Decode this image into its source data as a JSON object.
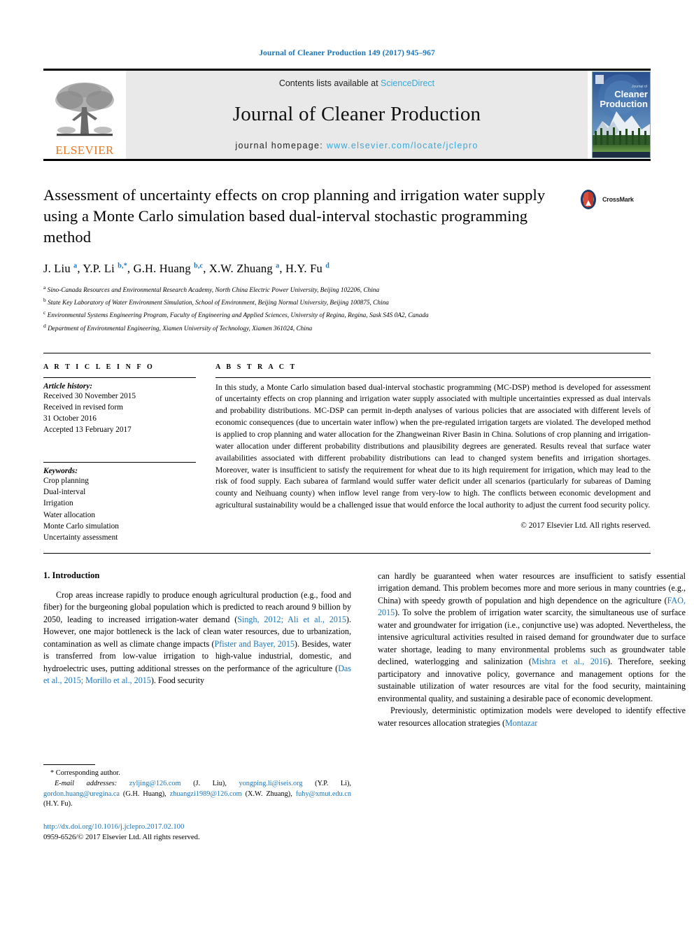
{
  "running_head": "Journal of Cleaner Production 149 (2017) 945–967",
  "masthead": {
    "publisher": "ELSEVIER",
    "contents_prefix": "Contents lists available at ",
    "contents_link": "ScienceDirect",
    "journal_title": "Journal of Cleaner Production",
    "homepage_prefix": "journal homepage: ",
    "homepage_url": "www.elsevier.com/locate/jclepro",
    "cover_line1": "Journal of",
    "cover_line2": "Cleaner",
    "cover_line3": "Production"
  },
  "article": {
    "title": "Assessment of uncertainty effects on crop planning and irrigation water supply using a Monte Carlo simulation based dual-interval stochastic programming method",
    "authors": "J. Liu a, Y.P. Li b,*, G.H. Huang b,c, X.W. Zhuang a, H.Y. Fu d",
    "author_parts": [
      {
        "name": "J. Liu ",
        "sup": "a"
      },
      {
        "name": ", Y.P. Li ",
        "sup": "b,*"
      },
      {
        "name": ", G.H. Huang ",
        "sup": "b,c"
      },
      {
        "name": ", X.W. Zhuang ",
        "sup": "a"
      },
      {
        "name": ", H.Y. Fu ",
        "sup": "d"
      }
    ],
    "affiliations": [
      {
        "marker": "a",
        "text": "Sino-Canada Resources and Environmental Research Academy, North China Electric Power University, Beijing 102206, China"
      },
      {
        "marker": "b",
        "text": "State Key Laboratory of Water Environment Simulation, School of Environment, Beijing Normal University, Beijing 100875, China"
      },
      {
        "marker": "c",
        "text": "Environmental Systems Engineering Program, Faculty of Engineering and Applied Sciences, University of Regina, Regina, Sask S4S 0A2, Canada"
      },
      {
        "marker": "d",
        "text": "Department of Environmental Engineering, Xiamen University of Technology, Xiamen 361024, China"
      }
    ],
    "crossmark_label": "CrossMark"
  },
  "article_info": {
    "heading": "A R T I C L E   I N F O",
    "history_label": "Article history:",
    "history": [
      "Received 30 November 2015",
      "Received in revised form",
      "31 October 2016",
      "Accepted 13 February 2017"
    ],
    "keywords_label": "Keywords:",
    "keywords": [
      "Crop planning",
      "Dual-interval",
      "Irrigation",
      "Water allocation",
      "Monte Carlo simulation",
      "Uncertainty assessment"
    ]
  },
  "abstract": {
    "heading": "A B S T R A C T",
    "text": "In this study, a Monte Carlo simulation based dual-interval stochastic programming (MC-DSP) method is developed for assessment of uncertainty effects on crop planning and irrigation water supply associated with multiple uncertainties expressed as dual intervals and probability distributions. MC-DSP can permit in-depth analyses of various policies that are associated with different levels of economic consequences (due to uncertain water inflow) when the pre-regulated irrigation targets are violated. The developed method is applied to crop planning and water allocation for the Zhangweinan River Basin in China. Solutions of crop planning and irrigation-water allocation under different probability distributions and plausibility degrees are generated. Results reveal that surface water availabilities associated with different probability distributions can lead to changed system benefits and irrigation shortages. Moreover, water is insufficient to satisfy the requirement for wheat due to its high requirement for irrigation, which may lead to the risk of food supply. Each subarea of farmland would suffer water deficit under all scenarios (particularly for subareas of Daming county and Neihuang county) when inflow level range from very-low to high. The conflicts between economic development and agricultural sustainability would be a challenged issue that would enforce the local authority to adjust the current food security policy.",
    "copyright": "© 2017 Elsevier Ltd. All rights reserved."
  },
  "body": {
    "section_title": "1. Introduction",
    "left_paragraph_1_a": "Crop areas increase rapidly to produce enough agricultural production (e.g., food and fiber) for the burgeoning global population which is predicted to reach around 9 billion by 2050, leading to increased irrigation-water demand (",
    "left_ref_1": "Singh, 2012; Ali et al., 2015",
    "left_paragraph_1_b": "). However, one major bottleneck is the lack of clean water resources, due to urbanization, contamination as well as climate change impacts (",
    "left_ref_2": "Pfister and Bayer, 2015",
    "left_paragraph_1_c": "). Besides, water is transferred from low-value irrigation to high-value industrial, domestic, and hydroelectric uses, putting additional stresses on the performance of the agriculture (",
    "left_ref_3": "Das et al., 2015; Morillo et al., 2015",
    "left_paragraph_1_d": "). Food security",
    "right_paragraph_1_a": "can hardly be guaranteed when water resources are insufficient to satisfy essential irrigation demand. This problem becomes more and more serious in many countries (e.g., China) with speedy growth of population and high dependence on the agriculture (",
    "right_ref_1": "FAO, 2015",
    "right_paragraph_1_b": "). To solve the problem of irrigation water scarcity, the simultaneous use of surface water and groundwater for irrigation (i.e., conjunctive use) was adopted. Nevertheless, the intensive agricultural activities resulted in raised demand for groundwater due to surface water shortage, leading to many environmental problems such as groundwater table declined, waterlogging and salinization (",
    "right_ref_2": "Mishra et al., 2016",
    "right_paragraph_1_c": "). Therefore, seeking participatory and innovative policy, governance and management options for the sustainable utilization of water resources are vital for the food security, maintaining environmental quality, and sustaining a desirable pace of economic development.",
    "right_paragraph_2_a": "Previously, deterministic optimization models were developed to identify effective water resources allocation strategies (",
    "right_ref_3": "Montazar"
  },
  "footnote": {
    "corresponding": "* Corresponding author.",
    "email_label": "E-mail addresses:",
    "emails": [
      {
        "addr": "zyljing@126.com",
        "owner": " (J. Liu), "
      },
      {
        "addr": "yongping.li@iseis.org",
        "owner": " (Y.P. Li), "
      },
      {
        "addr": "gordon.huang@uregina.ca",
        "owner": " (G.H. Huang), "
      },
      {
        "addr": "zhuangzi1989@126.com",
        "owner": " (X.W. Zhuang), "
      },
      {
        "addr": "fuhy@xmut.edu.cn",
        "owner": " (H.Y. Fu)."
      }
    ],
    "doi": "http://dx.doi.org/10.1016/j.jclepro.2017.02.100",
    "issn": "0959-6526/© 2017 Elsevier Ltd. All rights reserved."
  },
  "colors": {
    "link_blue": "#1b75bb",
    "sciencedirect_blue": "#3ba7d6",
    "elsevier_orange": "#e87722",
    "masthead_gray": "#e9e9e9"
  }
}
